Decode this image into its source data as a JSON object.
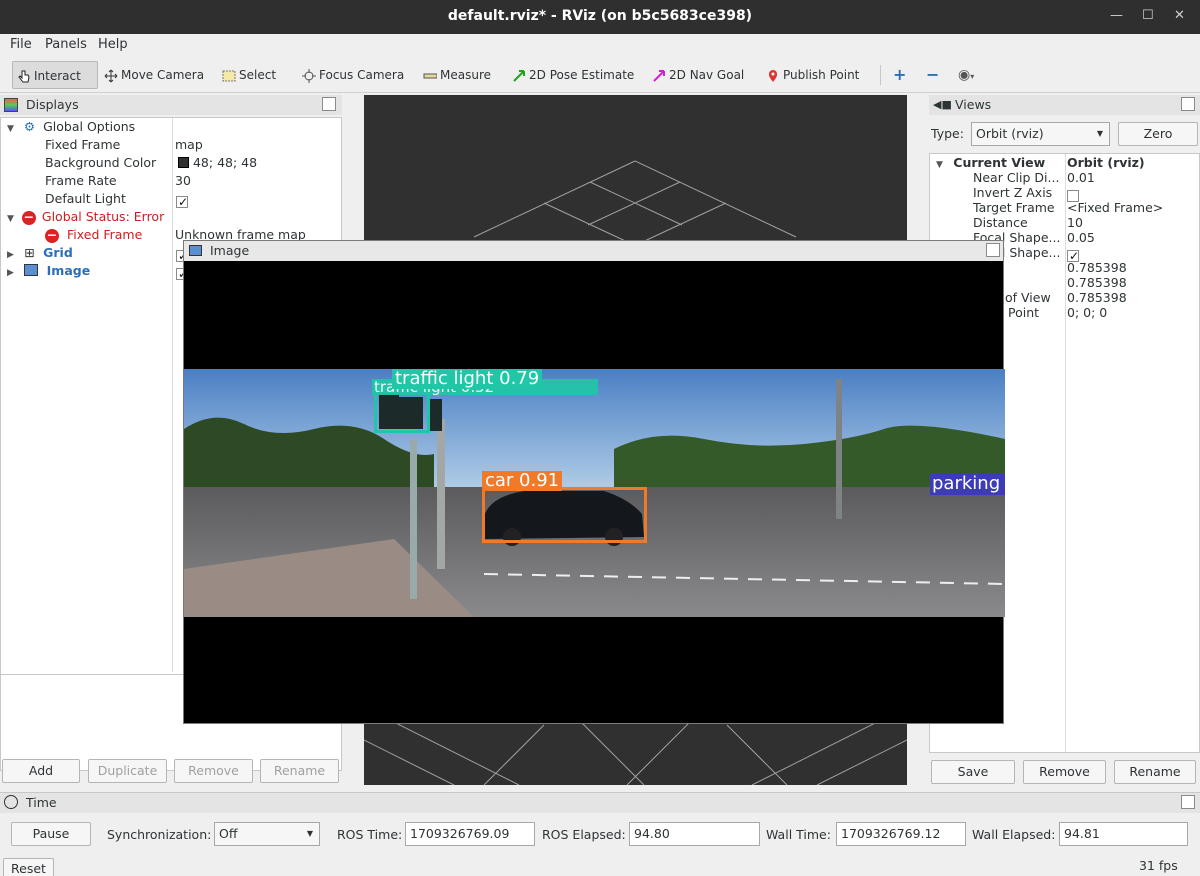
{
  "window": {
    "title": "default.rviz* - RViz (on b5c5683ce398)"
  },
  "menu": {
    "file": "File",
    "panels": "Panels",
    "help": "Help"
  },
  "toolbar": {
    "interact": "Interact",
    "move_camera": "Move Camera",
    "select": "Select",
    "focus_camera": "Focus Camera",
    "measure": "Measure",
    "pose_estimate": "2D Pose Estimate",
    "nav_goal": "2D Nav Goal",
    "publish_point": "Publish Point"
  },
  "displays": {
    "title": "Displays",
    "global_options": "Global Options",
    "props": [
      {
        "name": "Fixed Frame",
        "value": "map"
      },
      {
        "name": "Background Color",
        "value": "48; 48; 48"
      },
      {
        "name": "Frame Rate",
        "value": "30"
      },
      {
        "name": "Default Light",
        "value": ""
      }
    ],
    "global_status": "Global Status: Error",
    "fixed_frame_error": "Fixed Frame",
    "fixed_frame_error_value": "Unknown frame map",
    "grid": "Grid",
    "image": "Image",
    "buttons": {
      "add": "Add",
      "duplicate": "Duplicate",
      "remove": "Remove",
      "rename": "Rename"
    },
    "bg_color": "#303030"
  },
  "views": {
    "title": "Views",
    "type_label": "Type:",
    "type_value": "Orbit (rviz)",
    "zero": "Zero",
    "current_view": "Current View",
    "current_view_value": "Orbit (rviz)",
    "props": [
      {
        "name": "Near Clip Di...",
        "value": "0.01"
      },
      {
        "name": "Invert Z Axis",
        "value": ""
      },
      {
        "name": "Target Frame",
        "value": "<Fixed Frame>"
      },
      {
        "name": "Distance",
        "value": "10"
      },
      {
        "name": "Focal Shape...",
        "value": "0.05"
      },
      {
        "name": "Focal Shape...",
        "value": ""
      },
      {
        "name": "",
        "value": "0.785398"
      },
      {
        "name": "",
        "value": "0.785398"
      },
      {
        "name": "of View",
        "value": "0.785398"
      },
      {
        "name": "Point",
        "value": "0; 0; 0"
      }
    ],
    "buttons": {
      "save": "Save",
      "remove": "Remove",
      "rename": "Rename"
    }
  },
  "image_window": {
    "title": "Image",
    "detections": [
      {
        "label": "traffic light 0.79",
        "color": "#1fc7a6"
      },
      {
        "label": "traffic light 0.52",
        "color": "#1fc7a6"
      },
      {
        "label": "car 0.91",
        "color": "#f07a2a"
      },
      {
        "label": "parking",
        "color": "#3c3cb8"
      }
    ]
  },
  "time": {
    "title": "Time",
    "pause": "Pause",
    "sync_label": "Synchronization:",
    "sync_value": "Off",
    "ros_time_label": "ROS Time:",
    "ros_time": "1709326769.09",
    "ros_elapsed_label": "ROS Elapsed:",
    "ros_elapsed": "94.80",
    "wall_time_label": "Wall Time:",
    "wall_time": "1709326769.12",
    "wall_elapsed_label": "Wall Elapsed:",
    "wall_elapsed": "94.81",
    "reset": "Reset",
    "fps": "31 fps"
  }
}
